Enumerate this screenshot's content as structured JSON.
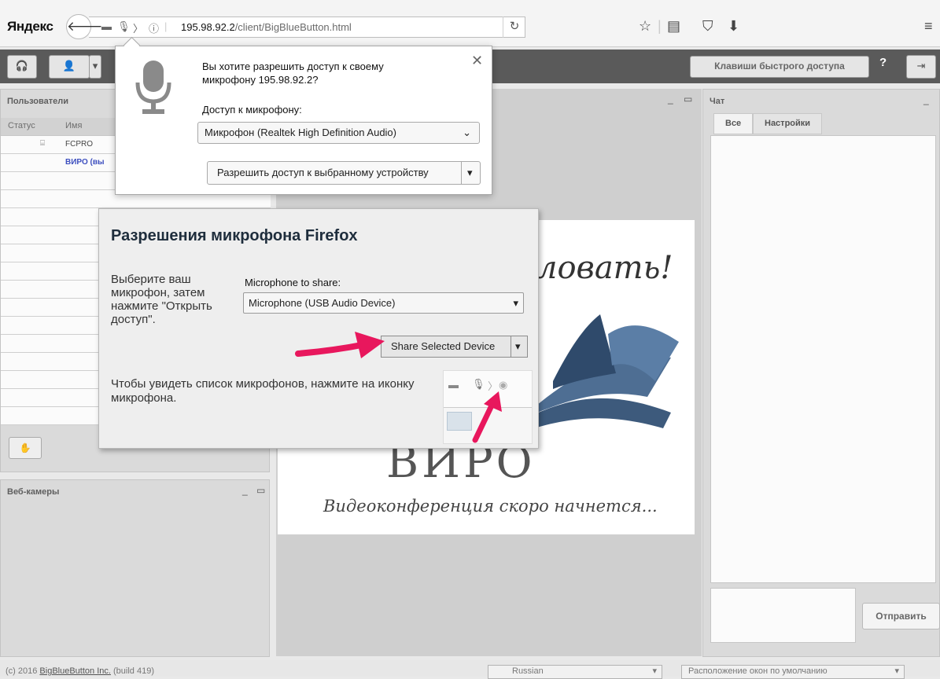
{
  "browser": {
    "brand": "Яндекс",
    "url_host": "195.98.92.2",
    "url_path": "/client/BigBlueButton.html"
  },
  "app_toolbar": {
    "shortcuts_label": "Клавиши быстрого доступа",
    "help_label": "?"
  },
  "users_panel": {
    "title": "Пользователи",
    "col_status": "Статус",
    "col_name": "Имя",
    "rows": [
      "FCPRO",
      "ВИРО (вы"
    ]
  },
  "webcams_panel": {
    "title": "Веб-камеры"
  },
  "slide": {
    "welcome_text": "ловать!",
    "logo_text": "ВИРО",
    "subtitle": "Видеоконференция скоро начнется..."
  },
  "chat_panel": {
    "title": "Чат",
    "tabs": [
      "Все",
      "Настройки"
    ],
    "send_label": "Отправить"
  },
  "footer": {
    "copyright": "(c) 2016",
    "link_text": "BigBlueButton Inc.",
    "build": "(build 419)",
    "language": "Russian",
    "layout": "Расположение окон по умолчанию"
  },
  "firefox_popup": {
    "question": "Вы хотите разрешить доступ к своему микрофону 195.98.92.2?",
    "access_label": "Доступ к микрофону:",
    "device_selected": "Микрофон (Realtek High Definition Audio)",
    "allow_label": "Разрешить доступ к выбранному устройству"
  },
  "dialog": {
    "title": "Разрешения микрофона Firefox",
    "instructions": "Выберите ваш микрофон, затем нажмите \"Открыть доступ\".",
    "mic_label": "Microphone to share:",
    "mic_selected": "Microphone (USB Audio Device)",
    "share_label": "Share Selected Device",
    "hint": "Чтобы увидеть список микрофонов, нажмите на иконку микрофона."
  },
  "colors": {
    "arrow": "#e8175d",
    "app_toolbar": "#5a5a5a",
    "dialog_title": "#1e2d3c"
  }
}
